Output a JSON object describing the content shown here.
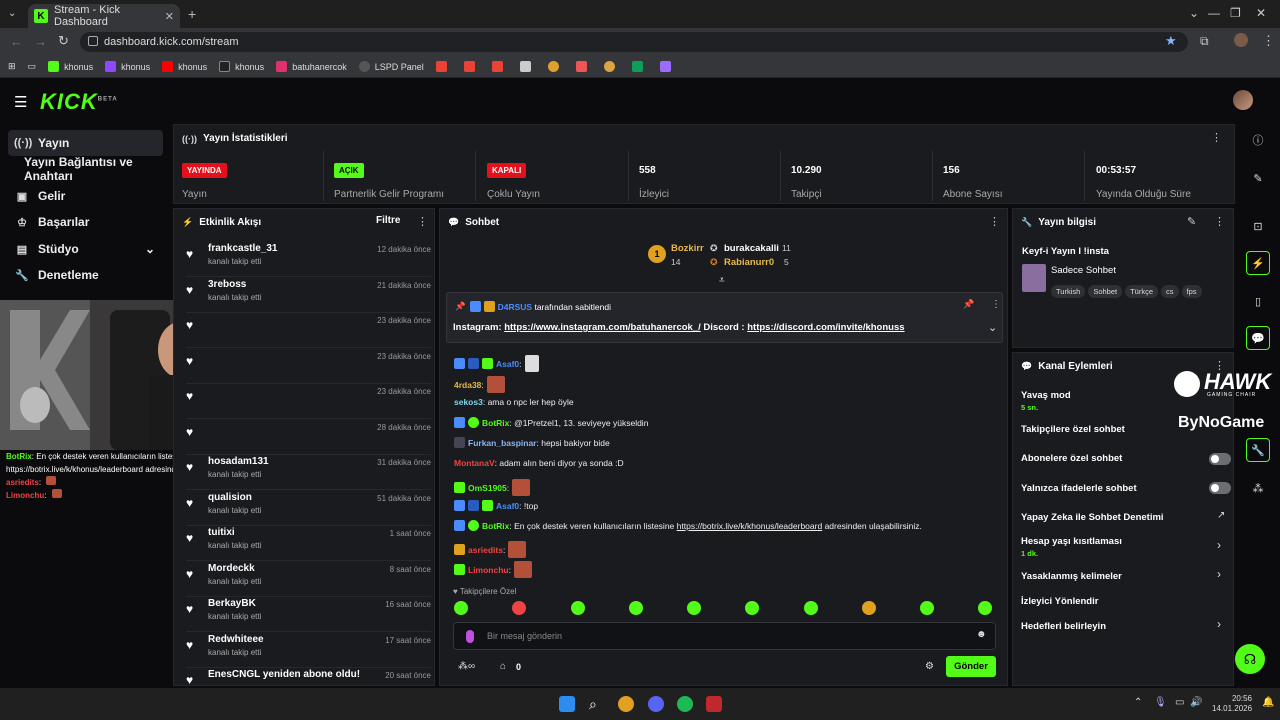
{
  "browser": {
    "tab_title": "Stream - Kick Dashboard",
    "url": "dashboard.kick.com/stream",
    "bookmarks": [
      {
        "label": "khonus",
        "color": "#53fc18"
      },
      {
        "label": "khonus",
        "color": "#9146ff"
      },
      {
        "label": "khonus",
        "color": "#ff0000"
      },
      {
        "label": "khonus",
        "color": "#e8e8e8"
      },
      {
        "label": "batuhanercok",
        "color": "#e1306c"
      },
      {
        "label": "LSPD Panel",
        "color": "#888888"
      }
    ]
  },
  "brand": {
    "logo": "KICK",
    "beta": "BETA",
    "accent": "#53fc18"
  },
  "sidebar": {
    "items": [
      {
        "label": "Yayın",
        "icon": "broadcast-icon"
      },
      {
        "label": "Yayın Bağlantısı ve Anahtarı",
        "icon": "key-icon"
      },
      {
        "label": "Gelir",
        "icon": "money-icon"
      },
      {
        "label": "Başarılar",
        "icon": "trophy-icon"
      },
      {
        "label": "Stüdyo",
        "icon": "studio-icon"
      },
      {
        "label": "Denetleme",
        "icon": "wrench-icon"
      }
    ]
  },
  "overlay_chat": [
    {
      "user": "BotRix",
      "text": ": En çok destek veren kullanıcıların listesine https://botrix.live/k/khonus/leaderboard adresinden ulaşabilirsiniz."
    },
    {
      "user": "asriedits",
      "text": ":"
    },
    {
      "user": "Limonchu",
      "text": ":"
    }
  ],
  "stats": {
    "title": "Yayın İstatistikleri",
    "items": [
      {
        "badge": "YAYINDA",
        "badge_color": "#e4111d",
        "label": "Yayın"
      },
      {
        "badge": "AÇIK",
        "badge_color": "#53fc18",
        "label": "Partnerlik Gelir Programı"
      },
      {
        "badge": "KAPALI",
        "badge_color": "#e4111d",
        "label": "Çoklu Yayın"
      },
      {
        "value": "558",
        "label": "İzleyici"
      },
      {
        "value": "10.290",
        "label": "Takipçi"
      },
      {
        "value": "156",
        "label": "Abone Sayısı"
      },
      {
        "value": "00:53:57",
        "label": "Yayında Olduğu Süre"
      }
    ]
  },
  "events": {
    "title": "Etkinlik Akışı",
    "filter": "Filtre",
    "items": [
      {
        "name": "frankcastle_31",
        "sub": "kanalı takip etti",
        "time": "12 dakika önce"
      },
      {
        "name": "3reboss",
        "sub": "kanalı takip etti",
        "time": "21 dakika önce"
      },
      {
        "name": "",
        "sub": "",
        "time": "23 dakika önce"
      },
      {
        "name": "",
        "sub": "",
        "time": "23 dakika önce"
      },
      {
        "name": "",
        "sub": "",
        "time": "23 dakika önce"
      },
      {
        "name": "",
        "sub": "",
        "time": "28 dakika önce"
      },
      {
        "name": "hosadam131",
        "sub": "kanalı takip etti",
        "time": "31 dakika önce"
      },
      {
        "name": "qualision",
        "sub": "kanalı takip etti",
        "time": "51 dakika önce"
      },
      {
        "name": "tuitixi",
        "sub": "kanalı takip etti",
        "time": "1 saat önce"
      },
      {
        "name": "Mordeckk",
        "sub": "kanalı takip etti",
        "time": "8 saat önce"
      },
      {
        "name": "BerkayBK",
        "sub": "kanalı takip etti",
        "time": "16 saat önce"
      },
      {
        "name": "Redwhiteee",
        "sub": "kanalı takip etti",
        "time": "17 saat önce"
      },
      {
        "name": "EnesCNGL yeniden abone oldu!",
        "sub": "",
        "time": "20 saat önce"
      }
    ]
  },
  "chat": {
    "title": "Sohbet",
    "top": {
      "first": "Bozkirr",
      "first_count": "14",
      "first_rank": "1",
      "second": "burakcakalli",
      "second_count": "11",
      "third": "Rabianurr0",
      "third_count": "5"
    },
    "pinned": {
      "by_user": "D4RSUS",
      "by_text": "tarafından sabitlendi",
      "lead1": "Instagram:",
      "link1": "https://www.instagram.com/batuhanercok_/",
      "lead2": "Discord :",
      "link2": "https://discord.com/invite/khonuss"
    },
    "messages": [
      {
        "user": "Asaf0",
        "color": "#4a8cff",
        "text": ":"
      },
      {
        "user": "4rda38",
        "color": "#e0b84a",
        "text": ":"
      },
      {
        "user": "sekos3",
        "color": "#7ed6f0",
        "text": ": ama o npc ler hep öyle"
      },
      {
        "user": "BotRix",
        "color": "#53fc18",
        "text": ": @1Pretzel1, 13. seviyeye yükseldin"
      },
      {
        "user": "Furkan_baspinar",
        "color": "#8ab4f8",
        "text": ": hepsi bakiyor bide"
      },
      {
        "user": "MontanaV",
        "color": "#e44",
        "text": ": adam alın beni diyor ya sonda :D"
      },
      {
        "user": "OmS1905",
        "color": "#53fc18",
        "text": ":"
      },
      {
        "user": "Asaf0",
        "color": "#4a8cff",
        "text": ": !top"
      },
      {
        "user": "BotRix",
        "color": "#53fc18",
        "text": ": En çok destek veren kullanıcıların listesine",
        "link": "https://botrix.live/k/khonus/leaderboard",
        "tail": "adresinden ulaşabilirsiniz."
      },
      {
        "user": "asriedits",
        "color": "#e44",
        "text": ":"
      },
      {
        "user": "Limonchu",
        "color": "#e44",
        "text": ":"
      }
    ],
    "followers_only": "Takipçilere Özel",
    "input_placeholder": "Bir mesaj gönderin",
    "points": "0",
    "send": "Gönder"
  },
  "stream_info": {
    "title": "Yayın bilgisi",
    "stream_title": "Keyf-i Yayın l !insta",
    "category": "Sadece Sohbet",
    "tags": [
      "Turkish",
      "Sohbet",
      "Türkçe",
      "cs",
      "fps"
    ]
  },
  "channel_actions": {
    "title": "Kanal Eylemleri",
    "items": [
      {
        "label": "Yavaş mod",
        "sub": "5 sn."
      },
      {
        "label": "Takipçilere özel sohbet",
        "sub": ""
      },
      {
        "label": "Abonelere özel sohbet",
        "sub": "",
        "control": "toggle"
      },
      {
        "label": "Yalnızca ifadelerle sohbet",
        "sub": "",
        "control": "toggle"
      },
      {
        "label": "Yapay Zeka ile Sohbet Denetimi",
        "sub": "",
        "control": "external"
      },
      {
        "label": "Hesap yaşı kısıtlaması",
        "sub": "1 dk.",
        "control": "chevron"
      },
      {
        "label": "Yasaklanmış kelimeler",
        "sub": "",
        "control": "chevron"
      },
      {
        "label": "İzleyici Yönlendir",
        "sub": ""
      },
      {
        "label": "Hedefleri belirleyin",
        "sub": "",
        "control": "chevron"
      }
    ],
    "watermark1": "HAWK",
    "watermark1_sub": "GAMING CHAIR",
    "watermark2": "ByNoGame"
  },
  "taskbar": {
    "time": "20:56",
    "date": "14.01.2026"
  }
}
